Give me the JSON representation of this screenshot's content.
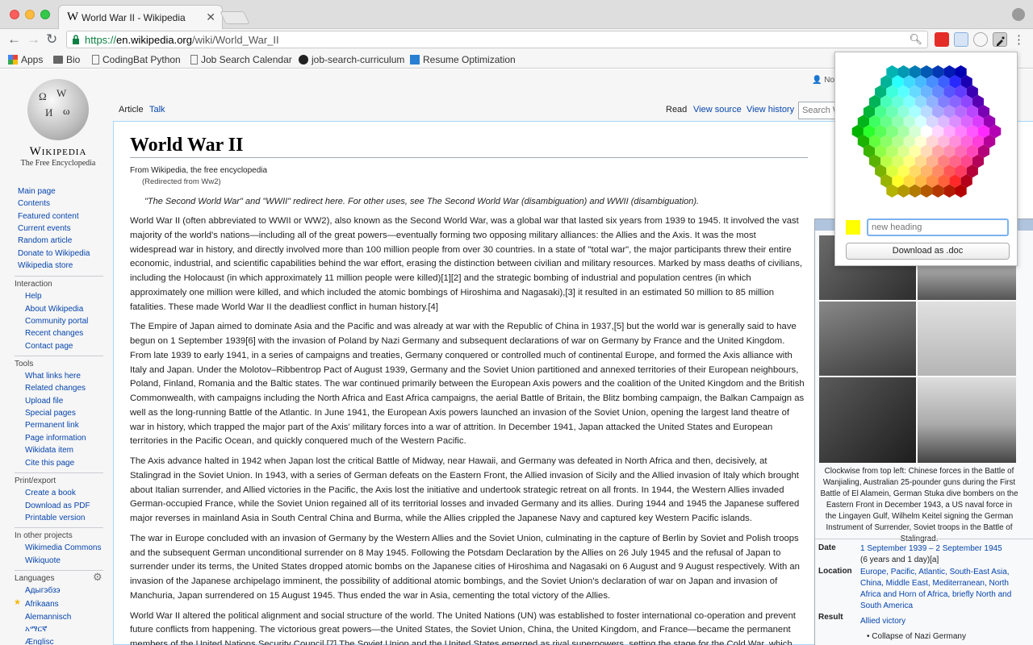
{
  "browser": {
    "tab_title": "World War II - Wikipedia",
    "url_scheme": "https://",
    "url_host": "en.wikipedia.org",
    "url_path": "/wiki/World_War_II",
    "bookmarks": [
      "Apps",
      "Bio",
      "CodingBat Python",
      "Job Search Calendar",
      "job-search-curriculum",
      "Resume Optimization"
    ]
  },
  "wiki": {
    "logo_wordmark": "Wikipedia",
    "logo_tagline": "The Free Encyclopedia",
    "personal": "Not",
    "nav": {
      "main": [
        "Main page",
        "Contents",
        "Featured content",
        "Current events",
        "Random article",
        "Donate to Wikipedia",
        "Wikipedia store"
      ],
      "interaction_header": "Interaction",
      "interaction": [
        "Help",
        "About Wikipedia",
        "Community portal",
        "Recent changes",
        "Contact page"
      ],
      "tools_header": "Tools",
      "tools": [
        "What links here",
        "Related changes",
        "Upload file",
        "Special pages",
        "Permanent link",
        "Page information",
        "Wikidata item",
        "Cite this page"
      ],
      "print_header": "Print/export",
      "print": [
        "Create a book",
        "Download as PDF",
        "Printable version"
      ],
      "projects_header": "In other projects",
      "projects": [
        "Wikimedia Commons",
        "Wikiquote"
      ],
      "languages_header": "Languages",
      "languages": [
        "Адыгэбзэ",
        "Afrikaans",
        "Alemannisch",
        "አማርኛ",
        "Ænglisc"
      ]
    },
    "tabs": {
      "article": "Article",
      "talk": "Talk",
      "read": "Read",
      "view_source": "View source",
      "view_history": "View history",
      "search_placeholder": "Search W"
    },
    "title": "World War II",
    "from": "From Wikipedia, the free encyclopedia",
    "redirected": "(Redirected from Ww2)",
    "hatnote": "\"The Second World War\" and \"WWII\" redirect here. For other uses, see The Second World War (disambiguation) and WWII (disambiguation).",
    "paragraphs": [
      "World War II (often abbreviated to WWII or WW2), also known as the Second World War, was a global war that lasted six years from 1939 to 1945. It involved the vast majority of the world's nations—including all of the great powers—eventually forming two opposing military alliances: the Allies and the Axis. It was the most widespread war in history, and directly involved more than 100 million people from over 30 countries. In a state of \"total war\", the major participants threw their entire economic, industrial, and scientific capabilities behind the war effort, erasing the distinction between civilian and military resources. Marked by mass deaths of civilians, including the Holocaust (in which approximately 11 million people were killed)[1][2] and the strategic bombing of industrial and population centres (in which approximately one million were killed, and which included the atomic bombings of Hiroshima and Nagasaki),[3] it resulted in an estimated 50 million to 85 million fatalities. These made World War II the deadliest conflict in human history.[4]",
      "The Empire of Japan aimed to dominate Asia and the Pacific and was already at war with the Republic of China in 1937,[5] but the world war is generally said to have begun on 1 September 1939[6] with the invasion of Poland by Nazi Germany and subsequent declarations of war on Germany by France and the United Kingdom. From late 1939 to early 1941, in a series of campaigns and treaties, Germany conquered or controlled much of continental Europe, and formed the Axis alliance with Italy and Japan. Under the Molotov–Ribbentrop Pact of August 1939, Germany and the Soviet Union partitioned and annexed territories of their European neighbours, Poland, Finland, Romania and the Baltic states. The war continued primarily between the European Axis powers and the coalition of the United Kingdom and the British Commonwealth, with campaigns including the North Africa and East Africa campaigns, the aerial Battle of Britain, the Blitz bombing campaign, the Balkan Campaign as well as the long-running Battle of the Atlantic. In June 1941, the European Axis powers launched an invasion of the Soviet Union, opening the largest land theatre of war in history, which trapped the major part of the Axis' military forces into a war of attrition. In December 1941, Japan attacked the United States and European territories in the Pacific Ocean, and quickly conquered much of the Western Pacific.",
      "The Axis advance halted in 1942 when Japan lost the critical Battle of Midway, near Hawaii, and Germany was defeated in North Africa and then, decisively, at Stalingrad in the Soviet Union. In 1943, with a series of German defeats on the Eastern Front, the Allied invasion of Sicily and the Allied invasion of Italy which brought about Italian surrender, and Allied victories in the Pacific, the Axis lost the initiative and undertook strategic retreat on all fronts. In 1944, the Western Allies invaded German-occupied France, while the Soviet Union regained all of its territorial losses and invaded Germany and its allies. During 1944 and 1945 the Japanese suffered major reverses in mainland Asia in South Central China and Burma, while the Allies crippled the Japanese Navy and captured key Western Pacific islands.",
      "The war in Europe concluded with an invasion of Germany by the Western Allies and the Soviet Union, culminating in the capture of Berlin by Soviet and Polish troops and the subsequent German unconditional surrender on 8 May 1945. Following the Potsdam Declaration by the Allies on 26 July 1945 and the refusal of Japan to surrender under its terms, the United States dropped atomic bombs on the Japanese cities of Hiroshima and Nagasaki on 6 August and 9 August respectively. With an invasion of the Japanese archipelago imminent, the possibility of additional atomic bombings, and the Soviet Union's declaration of war on Japan and invasion of Manchuria, Japan surrendered on 15 August 1945. Thus ended the war in Asia, cementing the total victory of the Allies.",
      "World War II altered the political alignment and social structure of the world. The United Nations (UN) was established to foster international co-operation and prevent future conflicts from happening. The victorious great powers—the United States, the Soviet Union, China, the United Kingdom, and France—became the permanent members of the United Nations Security Council.[7] The Soviet Union and the United States emerged as rival superpowers, setting the stage for the Cold War, which"
    ],
    "infobox": {
      "caption": "Clockwise from top left: Chinese forces in the Battle of Wanjialing, Australian 25-pounder guns during the First Battle of El Alamein, German Stuka dive bombers on the Eastern Front in December 1943, a US naval force in the Lingayen Gulf, Wilhelm Keitel signing the German Instrument of Surrender, Soviet troops in the Battle of Stalingrad.",
      "date_label": "Date",
      "date_value": "1 September 1939 – 2 September 1945",
      "date_sub": "(6 years and 1 day)[a]",
      "location_label": "Location",
      "location_value": "Europe, Pacific, Atlantic, South-East Asia, China, Middle East, Mediterranean, North Africa and Horn of Africa, briefly North and South America",
      "result_label": "Result",
      "result_value": "Allied victory",
      "result_bullet": "Collapse of Nazi Germany"
    }
  },
  "popup": {
    "swatch_color": "#ffff00",
    "heading_placeholder": "new heading",
    "download_label": "Download as .doc"
  }
}
